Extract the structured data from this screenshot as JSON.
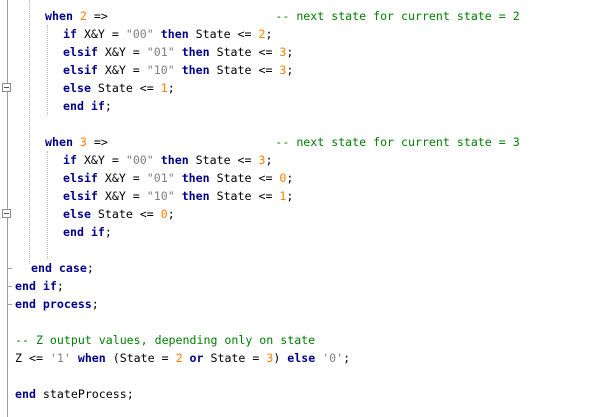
{
  "colors": {
    "keyword": "#00008b",
    "number": "#ff8000",
    "string": "#808080",
    "comment": "#008000",
    "text": "#000000",
    "background": "#ffffff"
  },
  "lines": [
    {
      "tokens": [
        {
          "t": "kw",
          "v": "when"
        },
        {
          "t": "sp",
          "v": " "
        },
        {
          "t": "num",
          "v": "2"
        },
        {
          "t": "sp",
          "v": " "
        },
        {
          "t": "txt",
          "v": "=>"
        },
        {
          "t": "sp",
          "v": "                        "
        },
        {
          "t": "cmt",
          "v": "-- next state for current state = 2"
        }
      ]
    },
    {
      "tokens": [
        {
          "t": "kw",
          "v": "if"
        },
        {
          "t": "sp",
          "v": " "
        },
        {
          "t": "txt",
          "v": "X&Y = "
        },
        {
          "t": "str",
          "v": "\"00\""
        },
        {
          "t": "sp",
          "v": " "
        },
        {
          "t": "kw",
          "v": "then"
        },
        {
          "t": "txt",
          "v": " State <= "
        },
        {
          "t": "num",
          "v": "2"
        },
        {
          "t": "txt",
          "v": ";"
        }
      ]
    },
    {
      "tokens": [
        {
          "t": "kw",
          "v": "elsif"
        },
        {
          "t": "txt",
          "v": " X&Y = "
        },
        {
          "t": "str",
          "v": "\"01\""
        },
        {
          "t": "sp",
          "v": " "
        },
        {
          "t": "kw",
          "v": "then"
        },
        {
          "t": "txt",
          "v": " State <= "
        },
        {
          "t": "num",
          "v": "3"
        },
        {
          "t": "txt",
          "v": ";"
        }
      ]
    },
    {
      "tokens": [
        {
          "t": "kw",
          "v": "elsif"
        },
        {
          "t": "txt",
          "v": " X&Y = "
        },
        {
          "t": "str",
          "v": "\"10\""
        },
        {
          "t": "sp",
          "v": " "
        },
        {
          "t": "kw",
          "v": "then"
        },
        {
          "t": "txt",
          "v": " State <= "
        },
        {
          "t": "num",
          "v": "3"
        },
        {
          "t": "txt",
          "v": ";"
        }
      ]
    },
    {
      "tokens": [
        {
          "t": "kw",
          "v": "else"
        },
        {
          "t": "txt",
          "v": " State <= "
        },
        {
          "t": "num",
          "v": "1"
        },
        {
          "t": "txt",
          "v": ";"
        }
      ]
    },
    {
      "tokens": [
        {
          "t": "kw",
          "v": "end if"
        },
        {
          "t": "txt",
          "v": ";"
        }
      ]
    },
    {
      "tokens": []
    },
    {
      "tokens": [
        {
          "t": "kw",
          "v": "when"
        },
        {
          "t": "sp",
          "v": " "
        },
        {
          "t": "num",
          "v": "3"
        },
        {
          "t": "sp",
          "v": " "
        },
        {
          "t": "txt",
          "v": "=>"
        },
        {
          "t": "sp",
          "v": "                        "
        },
        {
          "t": "cmt",
          "v": "-- next state for current state = 3"
        }
      ]
    },
    {
      "tokens": [
        {
          "t": "kw",
          "v": "if"
        },
        {
          "t": "sp",
          "v": " "
        },
        {
          "t": "txt",
          "v": "X&Y = "
        },
        {
          "t": "str",
          "v": "\"00\""
        },
        {
          "t": "sp",
          "v": " "
        },
        {
          "t": "kw",
          "v": "then"
        },
        {
          "t": "txt",
          "v": " State <= "
        },
        {
          "t": "num",
          "v": "3"
        },
        {
          "t": "txt",
          "v": ";"
        }
      ]
    },
    {
      "tokens": [
        {
          "t": "kw",
          "v": "elsif"
        },
        {
          "t": "txt",
          "v": " X&Y = "
        },
        {
          "t": "str",
          "v": "\"01\""
        },
        {
          "t": "sp",
          "v": " "
        },
        {
          "t": "kw",
          "v": "then"
        },
        {
          "t": "txt",
          "v": " State <= "
        },
        {
          "t": "num",
          "v": "0"
        },
        {
          "t": "txt",
          "v": ";"
        }
      ]
    },
    {
      "tokens": [
        {
          "t": "kw",
          "v": "elsif"
        },
        {
          "t": "txt",
          "v": " X&Y = "
        },
        {
          "t": "str",
          "v": "\"10\""
        },
        {
          "t": "sp",
          "v": " "
        },
        {
          "t": "kw",
          "v": "then"
        },
        {
          "t": "txt",
          "v": " State <= "
        },
        {
          "t": "num",
          "v": "1"
        },
        {
          "t": "txt",
          "v": ";"
        }
      ]
    },
    {
      "tokens": [
        {
          "t": "kw",
          "v": "else"
        },
        {
          "t": "txt",
          "v": " State <= "
        },
        {
          "t": "num",
          "v": "0"
        },
        {
          "t": "txt",
          "v": ";"
        }
      ]
    },
    {
      "tokens": [
        {
          "t": "kw",
          "v": "end if"
        },
        {
          "t": "txt",
          "v": ";"
        }
      ]
    },
    {
      "tokens": []
    },
    {
      "tokens": [
        {
          "t": "kw",
          "v": "end case"
        },
        {
          "t": "txt",
          "v": ";"
        }
      ]
    },
    {
      "tokens": [
        {
          "t": "kw",
          "v": "end if"
        },
        {
          "t": "txt",
          "v": ";"
        }
      ]
    },
    {
      "tokens": [
        {
          "t": "kw",
          "v": "end process"
        },
        {
          "t": "txt",
          "v": ";"
        }
      ]
    },
    {
      "tokens": []
    },
    {
      "tokens": [
        {
          "t": "cmt",
          "v": "-- Z output values, depending only on state"
        }
      ]
    },
    {
      "tokens": [
        {
          "t": "txt",
          "v": "Z <= "
        },
        {
          "t": "str",
          "v": "'1'"
        },
        {
          "t": "sp",
          "v": " "
        },
        {
          "t": "kw",
          "v": "when"
        },
        {
          "t": "txt",
          "v": " (State = "
        },
        {
          "t": "num",
          "v": "2"
        },
        {
          "t": "sp",
          "v": " "
        },
        {
          "t": "kw",
          "v": "or"
        },
        {
          "t": "txt",
          "v": " State = "
        },
        {
          "t": "num",
          "v": "3"
        },
        {
          "t": "txt",
          "v": ") "
        },
        {
          "t": "kw",
          "v": "else"
        },
        {
          "t": "sp",
          "v": " "
        },
        {
          "t": "str",
          "v": "'0'"
        },
        {
          "t": "txt",
          "v": ";"
        }
      ]
    },
    {
      "tokens": []
    },
    {
      "tokens": [
        {
          "t": "kw",
          "v": "end"
        },
        {
          "t": "txt",
          "v": " stateProcess;"
        }
      ]
    }
  ]
}
